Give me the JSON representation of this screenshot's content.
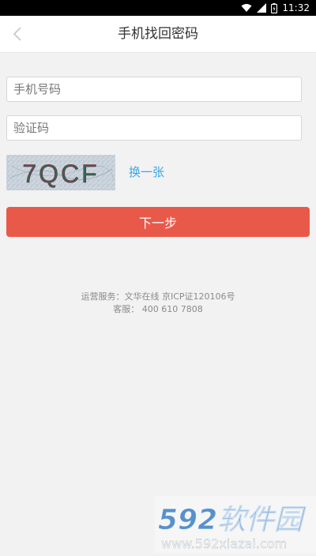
{
  "status_bar": {
    "time": "11:32",
    "icons": [
      "wifi-icon",
      "signal-icon",
      "battery-icon"
    ]
  },
  "header": {
    "title": "手机找回密码",
    "back_icon": "chevron-left-icon"
  },
  "form": {
    "phone_placeholder": "手机号码",
    "code_placeholder": "验证码",
    "captcha_text": "7QCF",
    "refresh_label": "换一张",
    "next_label": "下一步"
  },
  "footer": {
    "line1": "运营服务：文华在线 京ICP证120106号",
    "line2": "客服： 400 610 7808"
  },
  "watermark": {
    "brand": "592软件园",
    "url": "www.592xiazai.com"
  },
  "colors": {
    "accent": "#e9594a",
    "link": "#39a6e8",
    "background": "#f2f2f2"
  }
}
